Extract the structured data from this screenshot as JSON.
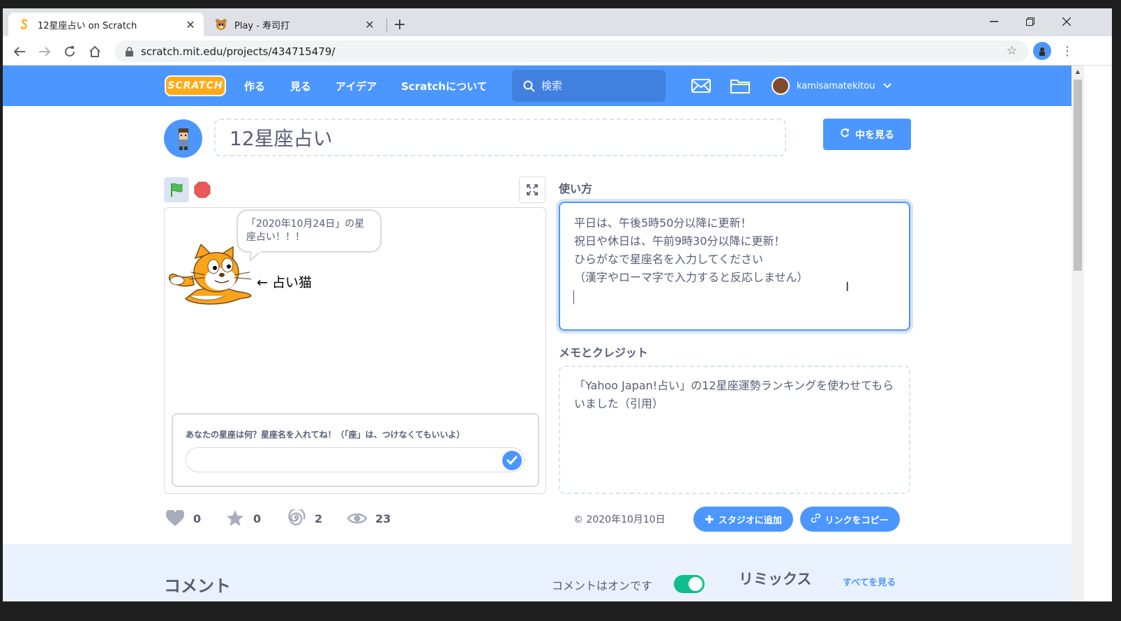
{
  "browser": {
    "tabs": [
      {
        "title": "12星座占い on Scratch",
        "active": true
      },
      {
        "title": "Play - 寿司打",
        "active": false
      }
    ],
    "url": "scratch.mit.edu/projects/434715479/"
  },
  "nav": {
    "logo": "SCRATCH",
    "links": [
      "作る",
      "見る",
      "アイデア",
      "Scratchについて"
    ],
    "search_placeholder": "検索",
    "username": "kamisamatekitou"
  },
  "project": {
    "title": "12星座占い",
    "see_inside_label": "中を見る"
  },
  "stage": {
    "speech": "「2020年10月24日」の星座占い！！！",
    "arrow_label": "← 占い猫",
    "ask_question": "あなたの星座は何？星座名を入れてね！（「座」は、つけなくてもいいよ）",
    "ask_value": ""
  },
  "instructions": {
    "heading": "使い方",
    "text": "平日は、午後5時50分以降に更新！\n祝日や休日は、午前9時30分以降に更新！\nひらがなで星座名を入力してください\n（漢字やローマ字で入力すると反応しません）"
  },
  "credits": {
    "heading": "メモとクレジット",
    "text": "「Yahoo Japan!占い」の12星座運勢ランキングを使わせてもらいました（引用）"
  },
  "stats": {
    "loves": "0",
    "favorites": "0",
    "remixes": "2",
    "views": "23"
  },
  "footer_actions": {
    "date": "2020年10月10日",
    "add_to_studio": "スタジオに追加",
    "copy_link": "リンクをコピー"
  },
  "bottom": {
    "comments_heading": "コメント",
    "comments_on": "コメントはオンです",
    "remix_heading": "リミックス",
    "see_all": "すべてを見る"
  },
  "colors": {
    "scratch_blue": "#4c97ff",
    "text_gray": "#575e75",
    "toggle_green": "#0fbd8c"
  }
}
